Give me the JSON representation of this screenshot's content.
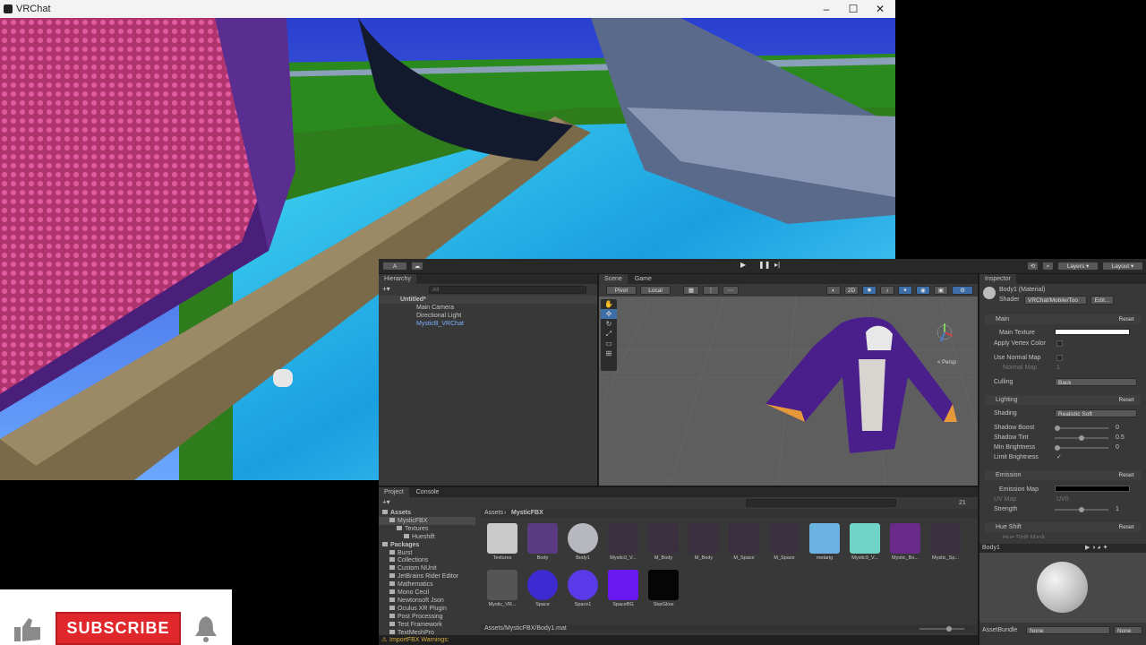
{
  "vrchat": {
    "title": "VRChat",
    "controls": {
      "minimize": "–",
      "maximize": "☐",
      "close": "✕"
    }
  },
  "subscribe": {
    "label": "SUBSCRIBE",
    "like_icon": "thumbs-up-icon",
    "bell_icon": "bell-icon"
  },
  "unity": {
    "toolbar": {
      "account": "A",
      "layers": "Layers",
      "layout": "Layout"
    },
    "hierarchy": {
      "tab": "Hierarchy",
      "search_placeholder": "All",
      "scene": "Untitled*",
      "items": [
        "Main Camera",
        "Directional Light",
        "MysticB_VRChat"
      ]
    },
    "scene_view": {
      "tabs": [
        "Scene",
        "Game"
      ],
      "pivot": "Pivot",
      "local": "Local",
      "mode_2d": "2D",
      "persp": "< Persp"
    },
    "inspector": {
      "tab": "Inspector",
      "title": "Body1 (Material)",
      "shader_label": "Shader",
      "shader_value": "VRChat/Mobile/Too",
      "edit_button": "Edit...",
      "sections": {
        "main": {
          "label": "Main",
          "reset": "Reset",
          "main_texture": "Main Texture",
          "apply_vertex_color": "Apply Vertex Color",
          "use_normal_map": "Use Normal Map",
          "normal_map": "Normal Map",
          "normal_map_value": "1",
          "culling": "Culling",
          "culling_value": "Back"
        },
        "lighting": {
          "label": "Lighting",
          "reset": "Reset",
          "shading": "Shading",
          "shading_value": "Realistic Soft",
          "shadow_boost": "Shadow Boost",
          "shadow_boost_value": "0",
          "shadow_tint": "Shadow Tint",
          "shadow_tint_value": "0.5",
          "min_brightness": "Min Brightness",
          "min_brightness_value": "0",
          "limit_brightness": "Limit Brightness",
          "shadow_boost_fraction": 0,
          "shadow_tint_fraction": 0.5,
          "min_brightness_fraction": 0
        },
        "emission": {
          "label": "Emission",
          "reset": "Reset",
          "emission_map": "Emission Map",
          "uv_map": "UV Map",
          "uv_map_value": "UV0",
          "strength": "Strength",
          "strength_value": "1",
          "strength_fraction": 0.5
        },
        "hue_shift": {
          "label": "Hue Shift",
          "reset": "Reset",
          "hue_shift_mask": "Hue Shift Mask"
        }
      },
      "preview_name": "Body1",
      "asset_bundle_label": "AssetBundle",
      "asset_bundle_value": "None",
      "asset_bundle_variant": "None"
    },
    "project": {
      "tabs": [
        "Project",
        "Console"
      ],
      "breadcrumb": [
        "Assets",
        "MysticFBX"
      ],
      "visible_count": "21",
      "tree": [
        {
          "label": "Assets",
          "indent": 0,
          "bold": true
        },
        {
          "label": "MysticFBX",
          "indent": 1,
          "bold": false,
          "selected": true
        },
        {
          "label": "Textures",
          "indent": 2,
          "bold": false
        },
        {
          "label": "Hueshift",
          "indent": 3,
          "bold": false
        },
        {
          "label": "Packages",
          "indent": 0,
          "bold": true
        },
        {
          "label": "Burst",
          "indent": 1,
          "bold": false
        },
        {
          "label": "Collections",
          "indent": 1,
          "bold": false
        },
        {
          "label": "Custom NUnit",
          "indent": 1,
          "bold": false
        },
        {
          "label": "JetBrains Rider Editor",
          "indent": 1,
          "bold": false
        },
        {
          "label": "Mathematics",
          "indent": 1,
          "bold": false
        },
        {
          "label": "Mono Cecil",
          "indent": 1,
          "bold": false
        },
        {
          "label": "Newtonsoft Json",
          "indent": 1,
          "bold": false
        },
        {
          "label": "Oculus XR Plugin",
          "indent": 1,
          "bold": false
        },
        {
          "label": "Post Processing",
          "indent": 1,
          "bold": false
        },
        {
          "label": "Test Framework",
          "indent": 1,
          "bold": false
        },
        {
          "label": "TextMeshPro",
          "indent": 1,
          "bold": false
        }
      ],
      "assets_row1": [
        {
          "label": "Textures",
          "color": "#c9c9c9"
        },
        {
          "label": "Body",
          "color": "#5a3a80"
        },
        {
          "label": "Body1",
          "color": "#b7b7c0"
        },
        {
          "label": "Mystic0_V...",
          "color": "#3a3040"
        },
        {
          "label": "M_Body",
          "color": "#3a3040"
        },
        {
          "label": "M_Body",
          "color": "#3a3040"
        },
        {
          "label": "M_Space",
          "color": "#3a3040"
        },
        {
          "label": "M_Space",
          "color": "#3a3040"
        },
        {
          "label": "metarig",
          "color": "#6bb3e0"
        },
        {
          "label": "Mystic9_V...",
          "color": "#6fd3c8"
        },
        {
          "label": "Mystic_Bo...",
          "color": "#6a2a8a"
        },
        {
          "label": "Mystic_Sp...",
          "color": "#3a3040"
        }
      ],
      "assets_row2": [
        {
          "label": "Mystic_VR...",
          "color": "#555555"
        },
        {
          "label": "Space",
          "color": "#3d2ad0"
        },
        {
          "label": "Space1",
          "color": "#5a3ae8"
        },
        {
          "label": "SpaceBG",
          "color": "#6a18f0"
        },
        {
          "label": "StarGlow",
          "color": "#050505"
        }
      ],
      "status_path": "Assets/MysticFBX/Body1.mat",
      "console_warning": "ImportFBX Warnings:"
    }
  }
}
